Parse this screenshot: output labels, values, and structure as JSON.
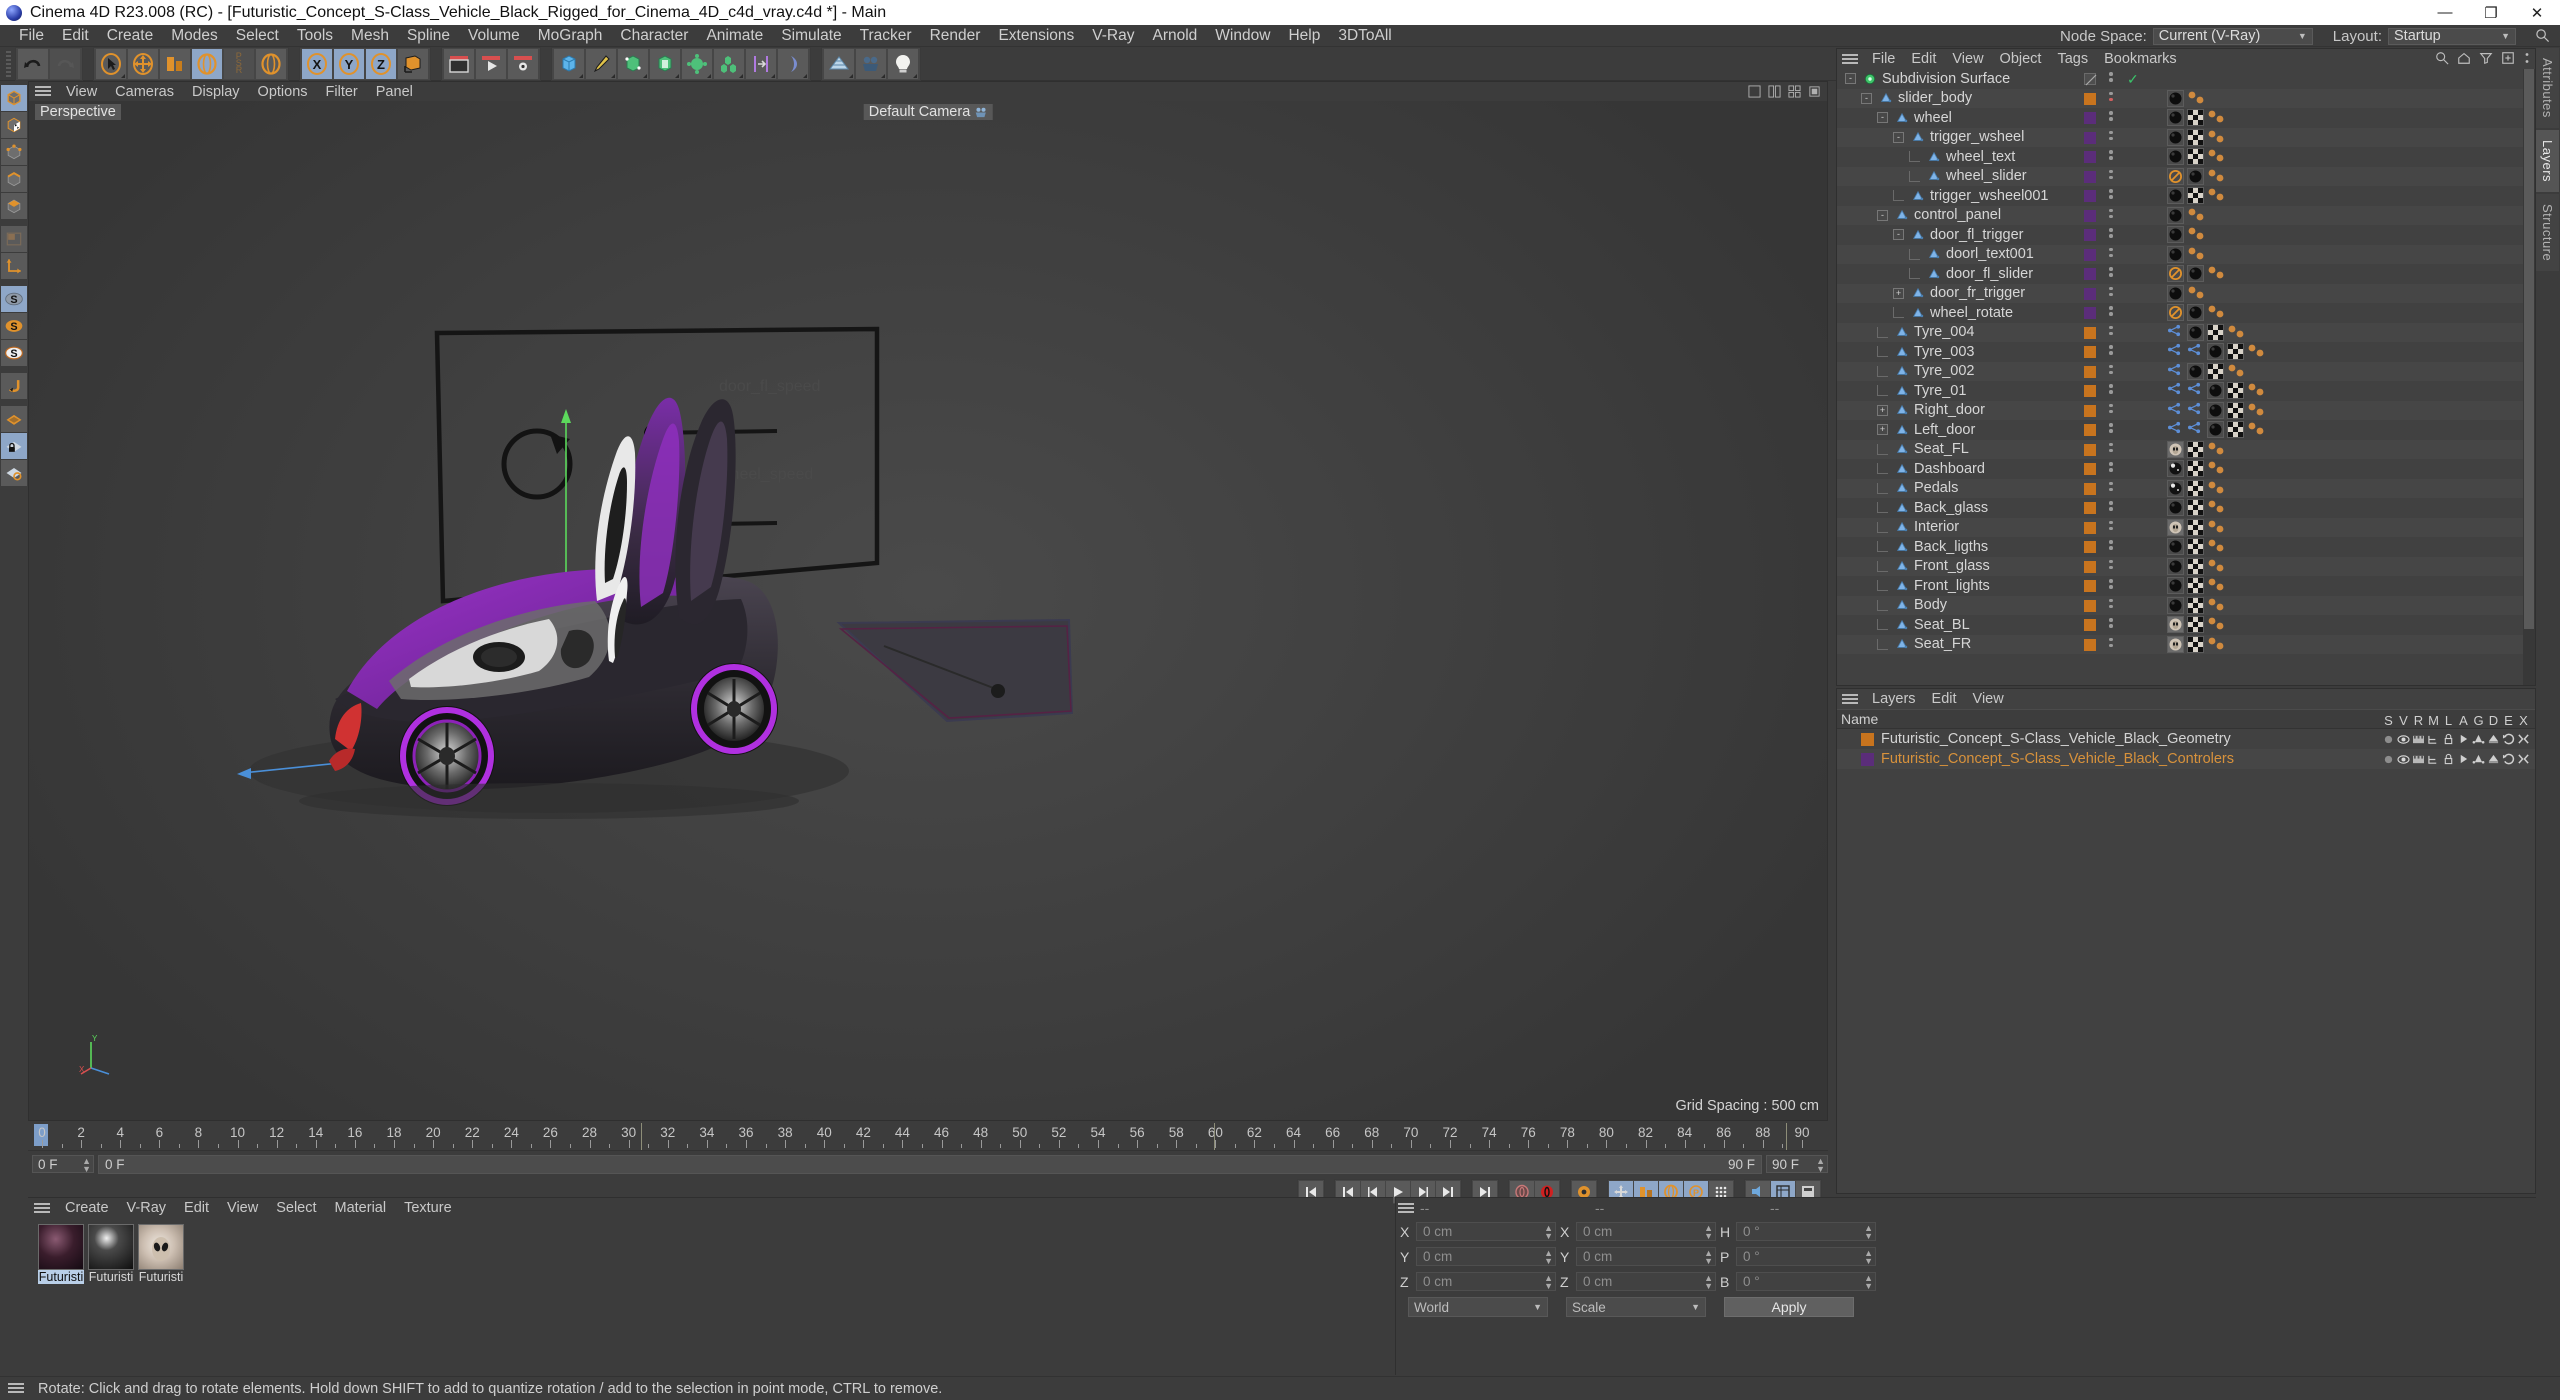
{
  "window": {
    "title": "Cinema 4D R23.008 (RC) - [Futuristic_Concept_S-Class_Vehicle_Black_Rigged_for_Cinema_4D_c4d_vray.c4d *] - Main",
    "minimize": "—",
    "maximize": "❐",
    "close": "✕"
  },
  "menubar": {
    "items": [
      "File",
      "Edit",
      "Create",
      "Modes",
      "Select",
      "Tools",
      "Mesh",
      "Spline",
      "Volume",
      "MoGraph",
      "Character",
      "Animate",
      "Simulate",
      "Tracker",
      "Render",
      "Extensions",
      "V-Ray",
      "Arnold",
      "Window",
      "Help",
      "3DToAll"
    ],
    "node_space_label": "Node Space:",
    "node_space_value": "Current (V-Ray)",
    "layout_label": "Layout:",
    "layout_value": "Startup"
  },
  "viewport": {
    "menu": [
      "View",
      "Cameras",
      "Display",
      "Options",
      "Filter",
      "Panel"
    ],
    "view_label": "Perspective",
    "camera_label": "Default Camera",
    "grid_spacing": "Grid Spacing : 500 cm",
    "axis_x": "X",
    "axis_y": "Y",
    "axis_z": "Z"
  },
  "timeline": {
    "ticks": [
      0,
      2,
      4,
      6,
      8,
      10,
      12,
      14,
      16,
      18,
      20,
      22,
      24,
      26,
      28,
      30,
      32,
      34,
      36,
      38,
      40,
      42,
      44,
      46,
      48,
      50,
      52,
      54,
      56,
      58,
      60,
      62,
      64,
      66,
      68,
      70,
      72,
      74,
      76,
      78,
      80,
      82,
      84,
      86,
      88,
      90
    ],
    "current_frame": "0 F",
    "track_start": "0 F",
    "track_end": "90 F",
    "range_end": "90 F",
    "end_field": "90 F",
    "right_field": "0 F"
  },
  "materials": {
    "menu": [
      "Create",
      "V-Ray",
      "Edit",
      "View",
      "Select",
      "Material",
      "Texture"
    ],
    "items": [
      {
        "name": "Futuristi",
        "selected": true
      },
      {
        "name": "Futuristi",
        "selected": false
      },
      {
        "name": "Futuristi",
        "selected": false
      }
    ]
  },
  "coordinates": {
    "header": [
      "--",
      "--",
      "--"
    ],
    "rows": [
      {
        "pos_label": "X",
        "pos_value": "0 cm",
        "size_label": "X",
        "size_value": "0 cm",
        "rot_label": "H",
        "rot_value": "0 °"
      },
      {
        "pos_label": "Y",
        "pos_value": "0 cm",
        "size_label": "Y",
        "size_value": "0 cm",
        "rot_label": "P",
        "rot_value": "0 °"
      },
      {
        "pos_label": "Z",
        "pos_value": "0 cm",
        "size_label": "Z",
        "size_value": "0 cm",
        "rot_label": "B",
        "rot_value": "0 °"
      }
    ],
    "world_select": "World",
    "scale_select": "Scale",
    "apply_button": "Apply"
  },
  "object_manager": {
    "menu": [
      "File",
      "Edit",
      "View",
      "Object",
      "Tags",
      "Bookmarks"
    ],
    "rows": [
      {
        "label": "Subdivision Surface",
        "depth": 0,
        "icon": "subdivision",
        "expander": "-",
        "chip": null,
        "tags": []
      },
      {
        "label": "slider_body",
        "depth": 1,
        "icon": "null-object",
        "expander": "-",
        "chip": "#c8741e",
        "tags": [
          "sphere-dark",
          "orange-dots"
        ],
        "dot2": "#d06060"
      },
      {
        "label": "wheel",
        "depth": 2,
        "icon": "null-object",
        "expander": "-",
        "chip": "#5b2d7a",
        "tags": [
          "sphere-dark",
          "checker",
          "orange-dots"
        ]
      },
      {
        "label": "trigger_wsheel",
        "depth": 3,
        "icon": "null-object",
        "expander": "-",
        "chip": "#5b2d7a",
        "tags": [
          "sphere-dark",
          "checker",
          "orange-dots"
        ]
      },
      {
        "label": "wheel_text",
        "depth": 4,
        "icon": "null-object",
        "expander": "",
        "chip": "#5b2d7a",
        "tags": [
          "sphere-dark",
          "checker",
          "orange-dots"
        ]
      },
      {
        "label": "wheel_slider",
        "depth": 4,
        "icon": "null-object",
        "expander": "",
        "chip": "#5b2d7a",
        "tags": [
          "noentry",
          "sphere-dark",
          "orange-dots"
        ]
      },
      {
        "label": "trigger_wsheel001",
        "depth": 3,
        "icon": "null-object",
        "expander": "",
        "chip": "#5b2d7a",
        "tags": [
          "sphere-dark",
          "checker",
          "orange-dots"
        ]
      },
      {
        "label": "control_panel",
        "depth": 2,
        "icon": "null-object",
        "expander": "-",
        "chip": "#5b2d7a",
        "tags": [
          "sphere-dark",
          "orange-dots"
        ]
      },
      {
        "label": "door_fl_trigger",
        "depth": 3,
        "icon": "null-object",
        "expander": "-",
        "chip": "#5b2d7a",
        "tags": [
          "sphere-dark",
          "orange-dots"
        ]
      },
      {
        "label": "doorl_text001",
        "depth": 4,
        "icon": "null-object",
        "expander": "",
        "chip": "#5b2d7a",
        "tags": [
          "sphere-dark",
          "orange-dots"
        ]
      },
      {
        "label": "door_fl_slider",
        "depth": 4,
        "icon": "null-object",
        "expander": "",
        "chip": "#5b2d7a",
        "tags": [
          "noentry",
          "sphere-dark",
          "orange-dots"
        ]
      },
      {
        "label": "door_fr_trigger",
        "depth": 3,
        "icon": "null-object",
        "expander": "+",
        "chip": "#5b2d7a",
        "tags": [
          "sphere-dark",
          "orange-dots"
        ]
      },
      {
        "label": "wheel_rotate",
        "depth": 3,
        "icon": "null-object",
        "expander": "",
        "chip": "#5b2d7a",
        "tags": [
          "noentry",
          "sphere-dark",
          "orange-dots"
        ]
      },
      {
        "label": "Tyre_004",
        "depth": 2,
        "icon": "null-object",
        "expander": "",
        "chip": "#c8741e",
        "tags": [
          "blue-node",
          "sphere-dark",
          "checker",
          "orange-dots"
        ]
      },
      {
        "label": "Tyre_003",
        "depth": 2,
        "icon": "null-object",
        "expander": "",
        "chip": "#c8741e",
        "tags": [
          "blue-node",
          "blue-node",
          "sphere-dark",
          "checker",
          "orange-dots"
        ]
      },
      {
        "label": "Tyre_002",
        "depth": 2,
        "icon": "null-object",
        "expander": "",
        "chip": "#c8741e",
        "tags": [
          "blue-node",
          "sphere-dark",
          "checker",
          "orange-dots"
        ]
      },
      {
        "label": "Tyre_01",
        "depth": 2,
        "icon": "null-object",
        "expander": "",
        "chip": "#c8741e",
        "tags": [
          "blue-node",
          "blue-node",
          "sphere-dark",
          "checker",
          "orange-dots"
        ]
      },
      {
        "label": "Right_door",
        "depth": 2,
        "icon": "null-object",
        "expander": "+",
        "chip": "#c8741e",
        "tags": [
          "blue-node",
          "blue-node",
          "sphere-dark",
          "checker",
          "orange-dots"
        ]
      },
      {
        "label": "Left_door",
        "depth": 2,
        "icon": "null-object",
        "expander": "+",
        "chip": "#c8741e",
        "tags": [
          "blue-node",
          "blue-node",
          "sphere-dark",
          "checker",
          "orange-dots"
        ]
      },
      {
        "label": "Seat_FL",
        "depth": 2,
        "icon": "null-object",
        "expander": "",
        "chip": "#c8741e",
        "tags": [
          "sphere-alien",
          "checker",
          "orange-dots"
        ]
      },
      {
        "label": "Dashboard",
        "depth": 2,
        "icon": "null-object",
        "expander": "",
        "chip": "#c8741e",
        "tags": [
          "sphere-gloss",
          "checker",
          "orange-dots"
        ]
      },
      {
        "label": "Pedals",
        "depth": 2,
        "icon": "null-object",
        "expander": "",
        "chip": "#c8741e",
        "tags": [
          "sphere-gloss",
          "checker",
          "orange-dots"
        ]
      },
      {
        "label": "Back_glass",
        "depth": 2,
        "icon": "null-object",
        "expander": "",
        "chip": "#c8741e",
        "tags": [
          "sphere-dark",
          "checker",
          "orange-dots"
        ]
      },
      {
        "label": "Interior",
        "depth": 2,
        "icon": "null-object",
        "expander": "",
        "chip": "#c8741e",
        "tags": [
          "sphere-alien",
          "checker",
          "orange-dots"
        ]
      },
      {
        "label": "Back_ligths",
        "depth": 2,
        "icon": "null-object",
        "expander": "",
        "chip": "#c8741e",
        "tags": [
          "sphere-dark",
          "checker",
          "orange-dots"
        ]
      },
      {
        "label": "Front_glass",
        "depth": 2,
        "icon": "null-object",
        "expander": "",
        "chip": "#c8741e",
        "tags": [
          "sphere-dark",
          "checker",
          "orange-dots"
        ]
      },
      {
        "label": "Front_lights",
        "depth": 2,
        "icon": "null-object",
        "expander": "",
        "chip": "#c8741e",
        "tags": [
          "sphere-dark",
          "checker",
          "orange-dots"
        ]
      },
      {
        "label": "Body",
        "depth": 2,
        "icon": "null-object",
        "expander": "",
        "chip": "#c8741e",
        "tags": [
          "sphere-dark",
          "checker",
          "orange-dots"
        ]
      },
      {
        "label": "Seat_BL",
        "depth": 2,
        "icon": "null-object",
        "expander": "",
        "chip": "#c8741e",
        "tags": [
          "sphere-alien",
          "checker",
          "orange-dots"
        ]
      },
      {
        "label": "Seat_FR",
        "depth": 2,
        "icon": "null-object",
        "expander": "",
        "chip": "#c8741e",
        "tags": [
          "sphere-alien",
          "checker",
          "orange-dots"
        ]
      }
    ]
  },
  "layers_panel": {
    "menu": [
      "Layers",
      "Edit",
      "View"
    ],
    "name_column": "Name",
    "columns": [
      "S",
      "V",
      "R",
      "M",
      "L",
      "A",
      "G",
      "D",
      "E",
      "X"
    ],
    "rows": [
      {
        "name": "Futuristic_Concept_S-Class_Vehicle_Black_Geometry",
        "color": "#c8741e",
        "text_color": "#d4d4d4"
      },
      {
        "name": "Futuristic_Concept_S-Class_Vehicle_Black_Controlers",
        "color": "#5b2d7a",
        "text_color": "#d8923c"
      }
    ]
  },
  "right_tabs": [
    "Attributes",
    "Layers",
    "Structure"
  ],
  "statusbar": {
    "message": "Rotate: Click and drag to rotate elements. Hold down SHIFT to add to quantize rotation / add to the selection in point mode, CTRL to remove."
  }
}
